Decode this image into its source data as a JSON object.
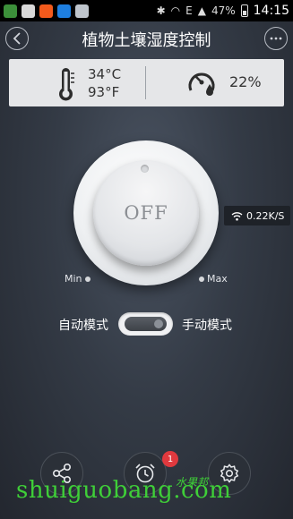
{
  "status_bar": {
    "signal_label": "E",
    "battery": "47%",
    "time": "14:15"
  },
  "header": {
    "title": "植物土壤湿度控制",
    "back_icon": "chevron-left-icon",
    "more_icon": "more-dots-icon"
  },
  "sensor": {
    "temp_c": "34°C",
    "temp_f": "93°F",
    "humidity": "22%",
    "thermo_icon": "thermometer-icon",
    "humidity_icon": "humidity-gauge-icon"
  },
  "knob": {
    "state_label": "OFF",
    "min_label": "Min",
    "max_label": "Max"
  },
  "network": {
    "speed": "0.22K/S"
  },
  "mode": {
    "left_label": "自动模式",
    "right_label": "手动模式"
  },
  "bottom": {
    "alarm_badge": "1"
  },
  "watermark": {
    "text": "shuiguobang.com",
    "logo_text": "水果邦"
  },
  "colors": {
    "accent_green": "#3fcf38",
    "badge_red": "#e0393e",
    "panel_bg": "#e5e6e8"
  }
}
